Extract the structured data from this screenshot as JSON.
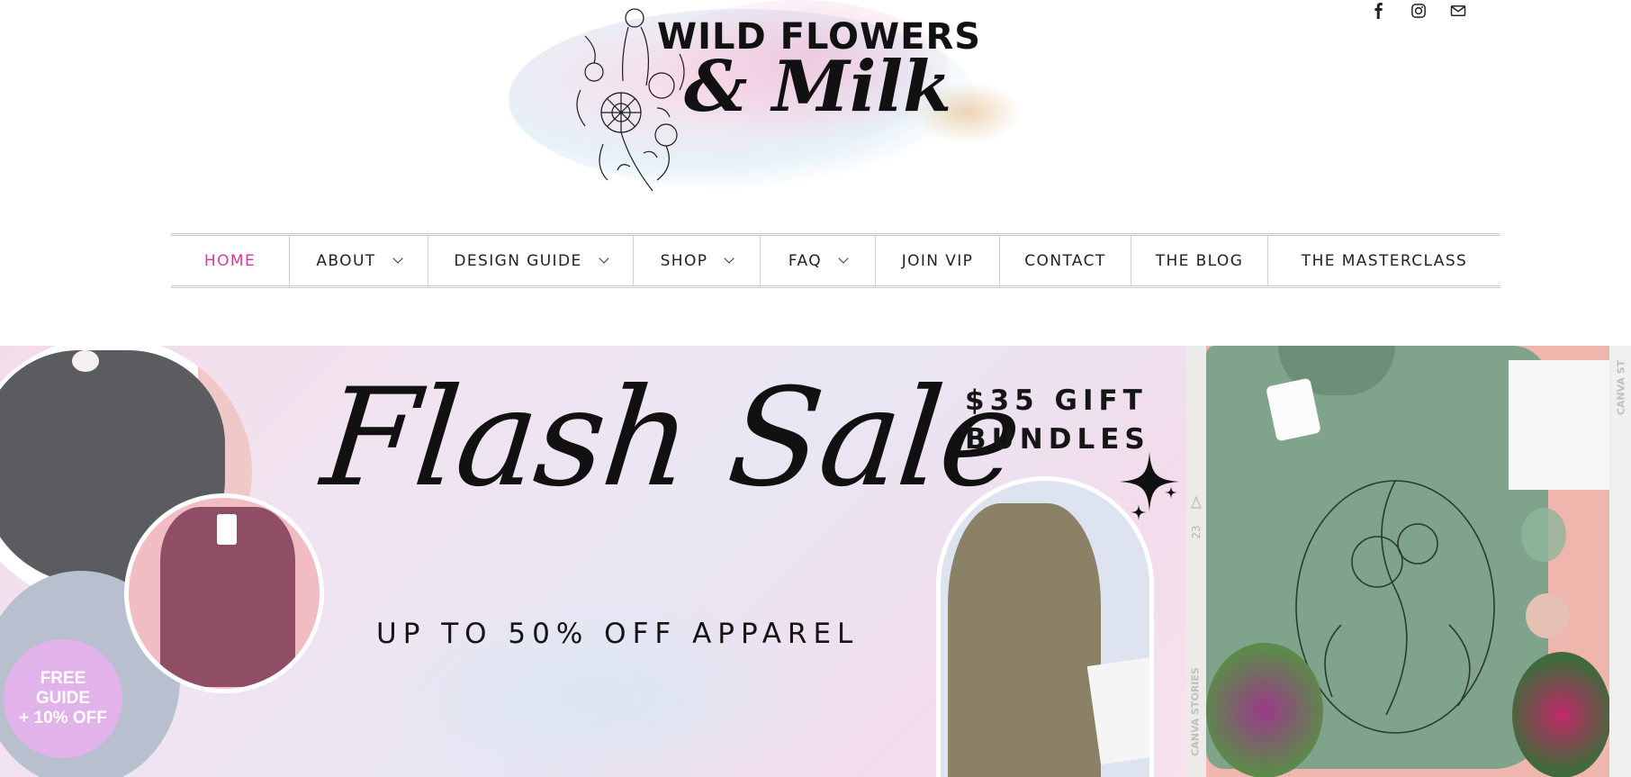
{
  "header": {
    "social": [
      {
        "name": "facebook-icon",
        "label": "facebook"
      },
      {
        "name": "instagram-icon",
        "label": "instagram"
      },
      {
        "name": "email-icon",
        "label": "email"
      }
    ],
    "logo": {
      "line1": "WILD FLOWERS",
      "line2": "& Milk"
    }
  },
  "nav": {
    "items": [
      {
        "label": "HOME",
        "active": true,
        "dropdown": false
      },
      {
        "label": "ABOUT",
        "active": false,
        "dropdown": true
      },
      {
        "label": "DESIGN GUIDE",
        "active": false,
        "dropdown": true
      },
      {
        "label": "SHOP",
        "active": false,
        "dropdown": true
      },
      {
        "label": "FAQ",
        "active": false,
        "dropdown": true
      },
      {
        "label": "JOIN VIP",
        "active": false,
        "dropdown": false
      },
      {
        "label": "CONTACT",
        "active": false,
        "dropdown": false
      },
      {
        "label": "THE BLOG",
        "active": false,
        "dropdown": false
      },
      {
        "label": "THE MASTERCLASS",
        "active": false,
        "dropdown": false
      }
    ],
    "active_color": "#d63aa2"
  },
  "hero": {
    "headline": "Flash Sale",
    "subline": "UP TO 50% OFF APPAREL",
    "gift_line1": "$35 GIFT",
    "gift_line2": "BUNDLES",
    "badge_line1": "FREE",
    "badge_line2": "GUIDE",
    "badge_line3": "+ 10% OFF",
    "badge_color": "#e2b2ea",
    "strip_text": "CANVA STORIES",
    "strip_number": "23",
    "edge_text": "CANVA ST"
  }
}
